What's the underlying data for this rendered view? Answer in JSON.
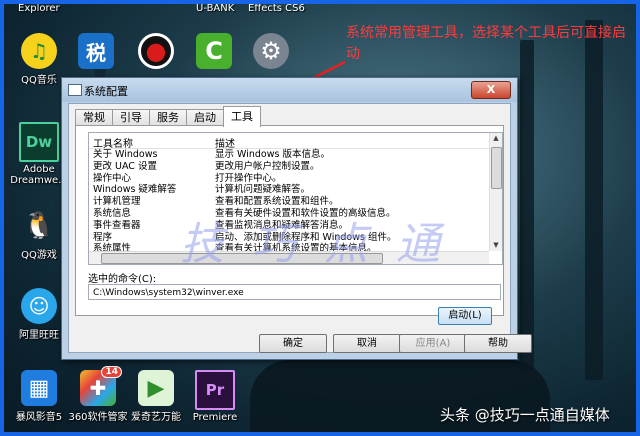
{
  "desktop": {
    "top_labels": [
      "Explorer",
      "U-BANK",
      "Effects CS6"
    ],
    "icons": [
      {
        "label": "QQ音乐",
        "glyph": "♫",
        "color": "#f7d21d"
      },
      {
        "label": "Adobe",
        "label2": "Dreamwe...",
        "glyph": "Dw",
        "color": "#0f5a45"
      },
      {
        "label": "QQ游戏",
        "glyph": "🐧",
        "color": "#1c82d9"
      },
      {
        "label": "阿里旺旺",
        "glyph": "☺",
        "color": "#2aa6ea"
      },
      {
        "label": "暴风影音5",
        "glyph": "▦",
        "color": "#1f7de0"
      },
      {
        "label": "360软件管家",
        "glyph": "✚",
        "color": "#e6443a",
        "badge": "14"
      },
      {
        "label": "爱奇艺万能",
        "glyph": "▶",
        "color": "#4caf50"
      },
      {
        "label": "Premiere",
        "glyph": "Pr",
        "color": "#2a0f3f"
      }
    ],
    "top_icons": [
      {
        "glyph": "税",
        "color": "#1a6fc6"
      },
      {
        "glyph": "●",
        "color": "#d81b1b"
      },
      {
        "glyph": "C",
        "color": "#48b02c"
      },
      {
        "glyph": "⚙",
        "color": "#bfc6cf"
      }
    ]
  },
  "annotation": "系统常用管理工具，选择某个工具后可直接启动",
  "watermark": "技巧点通",
  "dialog": {
    "title": "系统配置",
    "close": "X",
    "tabs": [
      "常规",
      "引导",
      "服务",
      "启动",
      "工具"
    ],
    "active_tab": "工具",
    "columns": [
      "工具名称",
      "描述"
    ],
    "rows": [
      {
        "name": "关于 Windows",
        "desc": "显示 Windows 版本信息。"
      },
      {
        "name": "更改 UAC 设置",
        "desc": "更改用户帐户控制设置。"
      },
      {
        "name": "操作中心",
        "desc": "打开操作中心。"
      },
      {
        "name": "Windows 疑难解答",
        "desc": "计算机问题疑难解答。"
      },
      {
        "name": "计算机管理",
        "desc": "查看和配置系统设置和组件。"
      },
      {
        "name": "系统信息",
        "desc": "查看有关硬件设置和软件设置的高级信息。"
      },
      {
        "name": "事件查看器",
        "desc": "查看监视消息和疑难解答消息。"
      },
      {
        "name": "程序",
        "desc": "启动、添加或删除程序和 Windows 组件。"
      },
      {
        "name": "系统属性",
        "desc": "查看有关计算机系统设置的基本信息。"
      }
    ],
    "selected_command_label": "选中的命令(C):",
    "selected_command": "C:\\Windows\\system32\\winver.exe",
    "launch_button": "启动(L)",
    "buttons": {
      "ok": "确定",
      "cancel": "取消",
      "apply": "应用(A)",
      "help": "帮助"
    }
  },
  "credit": "头条 @技巧一点通自媒体"
}
